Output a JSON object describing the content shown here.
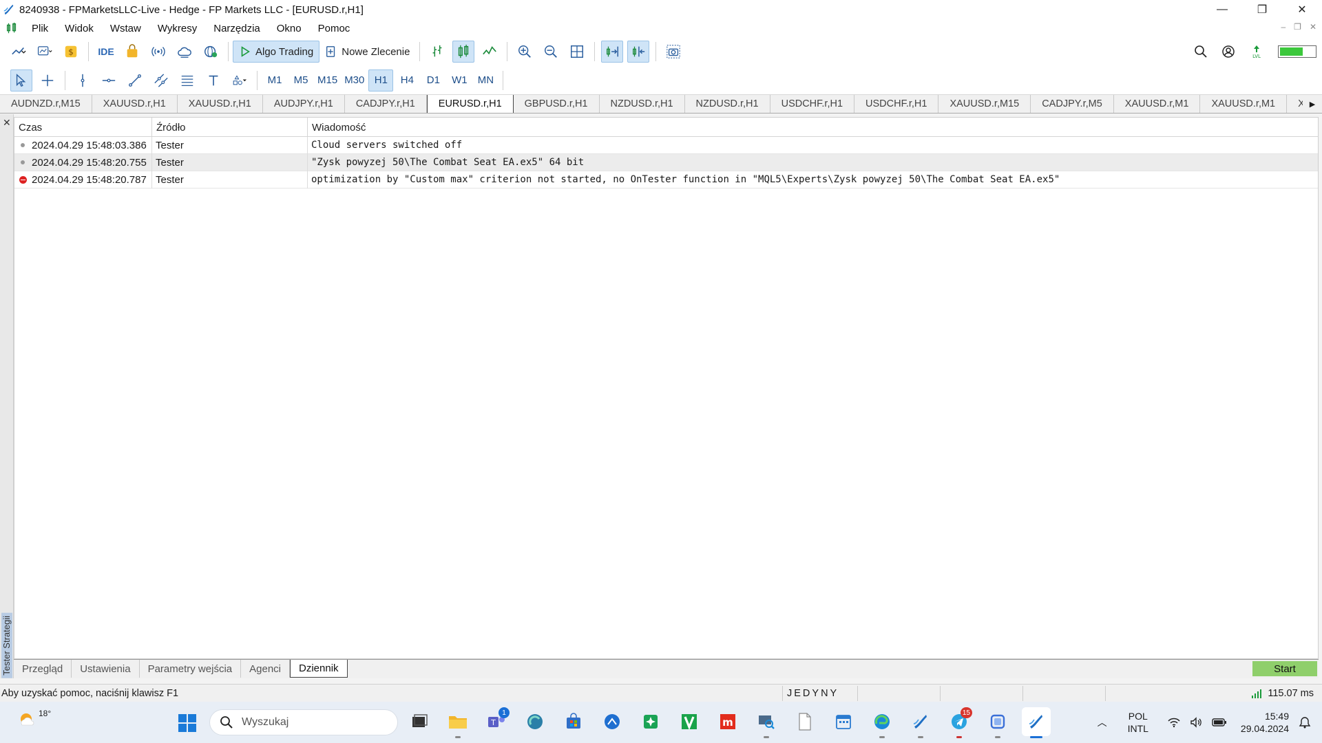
{
  "window": {
    "title": "8240938 - FPMarketsLLC-Live - Hedge - FP Markets LLC - [EURUSD.r,H1]",
    "controls": [
      "—",
      "❐",
      "✕"
    ]
  },
  "menu": {
    "items": [
      "Plik",
      "Widok",
      "Wstaw",
      "Wykresy",
      "Narzędzia",
      "Okno",
      "Pomoc"
    ],
    "mdi_controls": [
      "–",
      "❐",
      "✕"
    ]
  },
  "toolbar": {
    "ide_label": "IDE",
    "algo_trading_label": "Algo Trading",
    "new_order_label": "Nowe Zlecenie",
    "timeframes": [
      "M1",
      "M5",
      "M15",
      "M30",
      "H1",
      "H4",
      "D1",
      "W1",
      "MN"
    ],
    "active_timeframe": "H1",
    "battery_level": 0.65
  },
  "chart_tabs": {
    "items": [
      "AUDNZD.r,M15",
      "XAUUSD.r,H1",
      "XAUUSD.r,H1",
      "AUDJPY.r,H1",
      "CADJPY.r,H1",
      "EURUSD.r,H1",
      "GBPUSD.r,H1",
      "NZDUSD.r,H1",
      "NZDUSD.r,H1",
      "USDCHF.r,H1",
      "USDCHF.r,H1",
      "XAUUSD.r,M15",
      "CADJPY.r,M5",
      "XAUUSD.r,M1",
      "XAUUSD.r,M1",
      "XAUUSD"
    ],
    "active_index": 5
  },
  "tester": {
    "side_label": "Tester Strategii",
    "close_glyph": "✕",
    "columns": {
      "time": "Czas",
      "source": "Źródło",
      "message": "Wiadomość"
    },
    "rows": [
      {
        "time": "2024.04.29 15:48:03.386",
        "source": "Tester",
        "message": "Cloud servers switched off",
        "level": "info"
      },
      {
        "time": "2024.04.29 15:48:20.755",
        "source": "Tester",
        "message": "\"Zysk powyzej 50\\The Combat Seat EA.ex5\" 64 bit",
        "level": "info"
      },
      {
        "time": "2024.04.29 15:48:20.787",
        "source": "Tester",
        "message": "optimization by \"Custom max\" criterion not started, no OnTester function in \"MQL5\\Experts\\Zysk powyzej 50\\The Combat Seat EA.ex5\"",
        "level": "error"
      }
    ],
    "tabs": [
      "Przegląd",
      "Ustawienia",
      "Parametry wejścia",
      "Agenci",
      "Dziennik"
    ],
    "active_tab": "Dziennik",
    "start_label": "Start"
  },
  "statusbar": {
    "help": "Aby uzyskać pomoc, naciśnij klawisz F1",
    "profile": "JEDYNY",
    "ping": "115.07 ms"
  },
  "taskbar": {
    "weather_temp": "18°",
    "search_placeholder": "Wyszukaj",
    "apps": [
      {
        "name": "task-view-icon",
        "color": "#333"
      },
      {
        "name": "file-explorer-icon",
        "color": "#f2b52b"
      },
      {
        "name": "teams-icon",
        "color": "#5a5fc7",
        "badge": "1"
      },
      {
        "name": "edge-dev-icon",
        "color": "#2a7fa8"
      },
      {
        "name": "store-icon",
        "color": "#2f6ec7"
      },
      {
        "name": "app-blue-icon",
        "color": "#1f6fd0"
      },
      {
        "name": "app-green-icon",
        "color": "#1aa355"
      },
      {
        "name": "app-v-icon",
        "color": "#1aa34a"
      },
      {
        "name": "app-m-icon",
        "color": "#e22c1d"
      },
      {
        "name": "app-remote-icon",
        "color": "#4a6a8a"
      },
      {
        "name": "file-icon",
        "color": "#777"
      },
      {
        "name": "calendar-icon",
        "color": "#2a7bd0"
      },
      {
        "name": "edge-icon",
        "color": "#1a8ad8"
      },
      {
        "name": "metatrader-icon",
        "color": "#2a7bd0"
      },
      {
        "name": "telegram-icon",
        "color": "#2aa3e0",
        "badge": "15"
      },
      {
        "name": "app-square-icon",
        "color": "#3a6fd8"
      },
      {
        "name": "metatrader-active-icon",
        "color": "#2a7bd0"
      }
    ],
    "lang_top": "POL",
    "lang_bottom": "INTL",
    "time": "15:49",
    "date": "29.04.2024"
  },
  "colors": {
    "accent": "#cfe4f7",
    "start_button": "#8fcf6b",
    "error": "#dd2222"
  }
}
